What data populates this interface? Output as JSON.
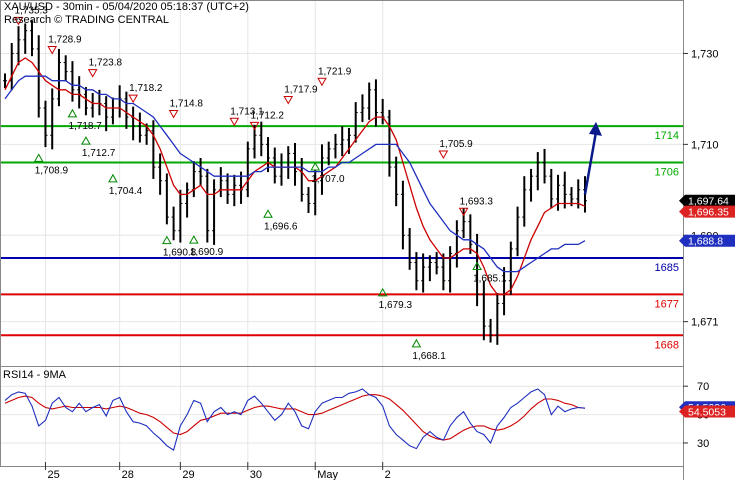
{
  "header": {
    "line1": "XAU/USD - 30min - 05/04/2020 05:18:37 (UTC+2)",
    "line2": "Research © TRADING CENTRAL"
  },
  "colors": {
    "price": "#000000",
    "ma_fast": "#cc0000",
    "ma_slow": "#1f2fbf",
    "support_green": "#00aa00",
    "pivot_blue": "#0000aa",
    "resistance_red": "#dd0000",
    "arrow": "#0a1a8a",
    "grid": "#e6e6e6",
    "last_price_bg": "#000000",
    "last_red_bg": "#dd2222",
    "last_blue_bg": "#1f2fbf"
  },
  "chart_data": [
    {
      "type": "line",
      "title": "XAU/USD - 30min",
      "ylim": [
        1663,
        1740
      ],
      "yticks": [
        "1,730",
        "1,710",
        "1,690",
        "1,671"
      ],
      "ytick_values": [
        1730,
        1710,
        1690,
        1671
      ],
      "xticks": [
        "25",
        "28",
        "29",
        "30",
        "May",
        "2"
      ],
      "grid": true,
      "levels": [
        {
          "label": "1714",
          "value": 1714,
          "color": "green"
        },
        {
          "label": "1706",
          "value": 1706,
          "color": "green"
        },
        {
          "label": "1685",
          "value": 1685,
          "color": "blue"
        },
        {
          "label": "1677",
          "value": 1677,
          "color": "red"
        },
        {
          "label": "1668",
          "value": 1668,
          "color": "red"
        }
      ],
      "last_values": [
        {
          "label": "1,697.64",
          "color": "black"
        },
        {
          "label": "1,696.35",
          "color": "red"
        },
        {
          "label": "1,688.8",
          "color": "blue"
        }
      ],
      "annotations": [
        {
          "text": "1,735.3",
          "value": 1735.3,
          "kind": "high"
        },
        {
          "text": "1,728.9",
          "value": 1728.9,
          "kind": "high"
        },
        {
          "text": "1,723.8",
          "value": 1723.8,
          "kind": "high"
        },
        {
          "text": "1,718.2",
          "value": 1718.2,
          "kind": "high"
        },
        {
          "text": "1,714.8",
          "value": 1714.8,
          "kind": "high"
        },
        {
          "text": "1,713.1",
          "value": 1713.1,
          "kind": "high"
        },
        {
          "text": "1,712.2",
          "value": 1712.2,
          "kind": "high"
        },
        {
          "text": "1,717.9",
          "value": 1717.9,
          "kind": "high"
        },
        {
          "text": "1,721.9",
          "value": 1721.9,
          "kind": "high"
        },
        {
          "text": "1,705.9",
          "value": 1705.9,
          "kind": "high"
        },
        {
          "text": "1,693.3",
          "value": 1693.3,
          "kind": "high"
        },
        {
          "text": "1,718.7",
          "value": 1718.7,
          "kind": "low"
        },
        {
          "text": "1,708.9",
          "value": 1708.9,
          "kind": "low"
        },
        {
          "text": "1,712.7",
          "value": 1712.7,
          "kind": "low"
        },
        {
          "text": "1,704.4",
          "value": 1704.4,
          "kind": "low"
        },
        {
          "text": "1,690.8",
          "value": 1690.8,
          "kind": "low"
        },
        {
          "text": "1,690.9",
          "value": 1690.9,
          "kind": "low"
        },
        {
          "text": "1,696.6",
          "value": 1696.6,
          "kind": "low"
        },
        {
          "text": "1,707.0",
          "value": 1707.0,
          "kind": "low"
        },
        {
          "text": "1,679.3",
          "value": 1679.3,
          "kind": "low"
        },
        {
          "text": "1,668.1",
          "value": 1668.1,
          "kind": "low"
        },
        {
          "text": "1,685.1",
          "value": 1685.1,
          "kind": "low"
        }
      ],
      "series": [
        {
          "name": "",
          "role": "price",
          "values": [
            1724,
            1730,
            1733,
            1735,
            1731,
            1718,
            1712,
            1720,
            1728,
            1726,
            1722,
            1721,
            1718,
            1719,
            1719,
            1716,
            1718,
            1720,
            1716,
            1714,
            1712,
            1713,
            1705,
            1702,
            1694,
            1691,
            1697,
            1700,
            1704,
            1703,
            1691,
            1700,
            1702,
            1699,
            1701,
            1700,
            1709,
            1712,
            1710,
            1707,
            1703,
            1705,
            1708,
            1704,
            1699,
            1697,
            1702,
            1707,
            1709,
            1710,
            1711,
            1712,
            1717,
            1718,
            1722,
            1717,
            1716,
            1705,
            1699,
            1690,
            1684,
            1680,
            1683,
            1684,
            1683,
            1680,
            1686,
            1691,
            1693,
            1688,
            1677,
            1670,
            1668,
            1675,
            1680,
            1687,
            1694,
            1700,
            1703,
            1706,
            1703,
            1698,
            1701,
            1699,
            1698,
            1700,
            1697.6
          ]
        },
        {
          "name": "",
          "role": "ma_fast",
          "values": [
            1722,
            1725,
            1728,
            1729,
            1728,
            1726,
            1724,
            1723,
            1722,
            1722,
            1721,
            1721,
            1720,
            1719,
            1719,
            1718,
            1718,
            1718,
            1717,
            1716,
            1715,
            1714,
            1712,
            1709,
            1705,
            1701,
            1699,
            1699,
            1700,
            1701,
            1699,
            1699,
            1700,
            1700,
            1700,
            1700,
            1702,
            1704,
            1705,
            1706,
            1705,
            1705,
            1705,
            1705,
            1704,
            1702,
            1702,
            1703,
            1704,
            1705,
            1707,
            1709,
            1711,
            1713,
            1715,
            1716,
            1716,
            1714,
            1711,
            1706,
            1701,
            1696,
            1692,
            1689,
            1687,
            1685,
            1685,
            1686,
            1687,
            1687,
            1686,
            1683,
            1679,
            1677,
            1677,
            1678,
            1681,
            1685,
            1689,
            1692,
            1695,
            1696,
            1697,
            1697,
            1697,
            1697,
            1696.4
          ]
        },
        {
          "name": "",
          "role": "ma_slow",
          "values": [
            1720,
            1722,
            1724,
            1725,
            1725,
            1725,
            1725,
            1724,
            1724,
            1724,
            1723,
            1723,
            1722,
            1722,
            1721,
            1721,
            1720,
            1720,
            1719,
            1719,
            1718,
            1717,
            1716,
            1714,
            1712,
            1710,
            1708,
            1707,
            1706,
            1705,
            1704,
            1703,
            1703,
            1703,
            1703,
            1703,
            1703,
            1704,
            1704,
            1705,
            1705,
            1705,
            1705,
            1705,
            1705,
            1704,
            1704,
            1704,
            1705,
            1705,
            1706,
            1706,
            1707,
            1708,
            1709,
            1710,
            1710,
            1710,
            1710,
            1708,
            1706,
            1703,
            1700,
            1697,
            1695,
            1693,
            1691,
            1690,
            1689,
            1689,
            1688,
            1687,
            1685,
            1683,
            1682,
            1682,
            1682,
            1683,
            1684,
            1685,
            1686,
            1687,
            1687,
            1688,
            1688,
            1688,
            1688.8
          ]
        }
      ]
    },
    {
      "type": "line",
      "title": "RSI14 - 9MA",
      "ylim": [
        18,
        80
      ],
      "yticks": [
        "70",
        "50",
        "30"
      ],
      "ytick_values": [
        70,
        50,
        30
      ],
      "last_values": [
        {
          "label": "54.5236",
          "color": "blue"
        },
        {
          "label": "54.5053",
          "color": "red"
        }
      ],
      "series": [
        {
          "name": "",
          "role": "rsi",
          "values": [
            60,
            64,
            66,
            65,
            56,
            42,
            46,
            58,
            62,
            55,
            52,
            58,
            52,
            55,
            57,
            49,
            60,
            62,
            52,
            45,
            44,
            42,
            37,
            33,
            28,
            25,
            42,
            50,
            60,
            58,
            45,
            52,
            55,
            50,
            52,
            50,
            60,
            63,
            58,
            52,
            46,
            50,
            58,
            52,
            42,
            40,
            52,
            58,
            60,
            62,
            62,
            65,
            66,
            68,
            64,
            62,
            56,
            42,
            36,
            32,
            28,
            26,
            34,
            38,
            34,
            32,
            42,
            48,
            52,
            44,
            38,
            36,
            30,
            42,
            48,
            55,
            58,
            62,
            66,
            68,
            64,
            50,
            56,
            52,
            54,
            55,
            54.5
          ]
        },
        {
          "name": "",
          "role": "rsi_ma",
          "values": [
            58,
            60,
            62,
            63,
            62,
            58,
            55,
            54,
            55,
            56,
            55,
            55,
            55,
            55,
            55,
            54,
            55,
            56,
            55,
            53,
            51,
            50,
            48,
            45,
            41,
            37,
            36,
            38,
            42,
            46,
            47,
            49,
            51,
            51,
            51,
            51,
            53,
            55,
            56,
            56,
            55,
            54,
            54,
            54,
            52,
            50,
            50,
            51,
            53,
            55,
            57,
            59,
            61,
            63,
            64,
            64,
            63,
            61,
            57,
            53,
            48,
            43,
            38,
            35,
            33,
            32,
            33,
            36,
            39,
            41,
            42,
            42,
            40,
            39,
            40,
            42,
            45,
            49,
            54,
            58,
            61,
            61,
            60,
            58,
            57,
            55,
            54.5
          ]
        }
      ]
    }
  ]
}
